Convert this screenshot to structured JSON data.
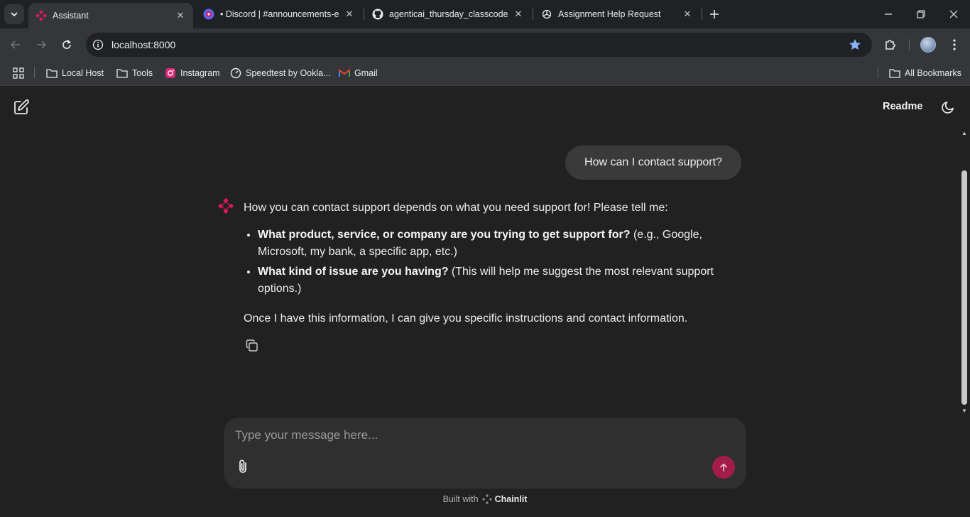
{
  "browser": {
    "tabs": [
      {
        "title": "Assistant",
        "active": true,
        "icon": "chainlit-icon"
      },
      {
        "title": "• Discord | #announcements-e",
        "active": false,
        "icon": "discord-icon"
      },
      {
        "title": "agenticai_thursday_classcode/cl",
        "active": false,
        "icon": "github-icon"
      },
      {
        "title": "Assignment Help Request",
        "active": false,
        "icon": "openai-icon"
      }
    ],
    "url": "localhost:8000",
    "bookmarks": [
      {
        "label": "Local Host",
        "icon": "folder-icon"
      },
      {
        "label": "Tools",
        "icon": "folder-icon"
      },
      {
        "label": "Instagram",
        "icon": "instagram-icon"
      },
      {
        "label": "Speedtest by Ookla...",
        "icon": "speedtest-icon"
      },
      {
        "label": "Gmail",
        "icon": "gmail-icon"
      }
    ],
    "all_bookmarks": "All Bookmarks",
    "accent": "#8ab4f8"
  },
  "app": {
    "header": {
      "readme": "Readme"
    },
    "user_message": "How can I contact support?",
    "assistant": {
      "intro": "How you can contact support depends on what you need support for!  Please tell me:",
      "bullets": [
        {
          "bold": "What product, service, or company are you trying to get support for?",
          "rest": " (e.g., Google, Microsoft, my bank, a specific app, etc.)"
        },
        {
          "bold": "What kind of issue are you having?",
          "rest": " (This will help me suggest the most relevant support options.)"
        }
      ],
      "outro": "Once I have this information, I can give you specific instructions and contact information."
    },
    "composer": {
      "placeholder": "Type your message here..."
    },
    "footer": {
      "built_with": "Built with",
      "brand": "Chainlit"
    },
    "colors": {
      "brand": "#e2185b",
      "send": "#a31d4a",
      "background": "#212121"
    }
  }
}
